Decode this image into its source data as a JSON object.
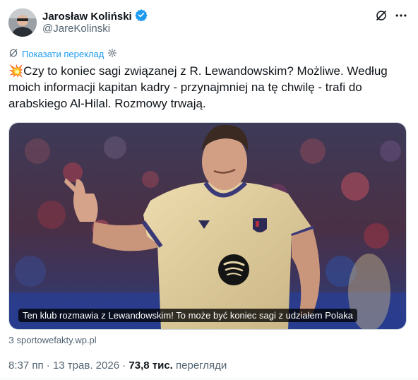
{
  "author": {
    "name": "Jarosław Koliński",
    "handle": "@JareKolinski"
  },
  "translate": {
    "label": "Показати переклад"
  },
  "post": {
    "emoji": "💥",
    "text": "Czy to koniec sagi związanej z R. Lewandowskim? Możliwe. Według moich informacji kapitan kadry - przynajmniej na tę chwilę - trafi do arabskiego Al-Hilal. Rozmowy trwają."
  },
  "media": {
    "caption": "Ten klub rozmawia z Lewandowskim! To może być koniec sagi z udziałem Polaka",
    "source": "З sportowefakty.wp.pl"
  },
  "meta": {
    "time": "8:37 пп",
    "separator": "·",
    "date": "13 трав. 2026",
    "views_count": "73,8 тис.",
    "views_label": "перегляди"
  },
  "colors": {
    "accent": "#1d9bf0",
    "shirt": "#e3d1a1",
    "muted": "#536471"
  },
  "icons": [
    "verified-badge-icon",
    "grok-icon",
    "more-icon",
    "translate-settings-icon",
    "club-crest-icon",
    "sponsor-logo-icon"
  ]
}
